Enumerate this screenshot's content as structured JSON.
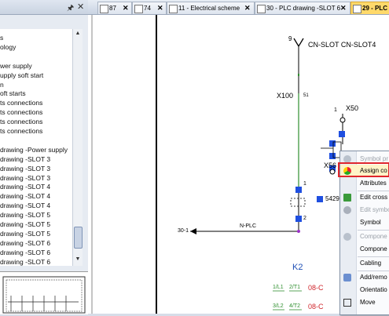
{
  "left_panel": {
    "pin_icon": "pin-icon",
    "tree_items": [
      {
        "label": "s"
      },
      {
        "label": "ology"
      },
      {
        "label": ""
      },
      {
        "label": "wer supply"
      },
      {
        "label": "upply soft start"
      },
      {
        "label": "n"
      },
      {
        "label": "oft starts"
      },
      {
        "label": "ts connections"
      },
      {
        "label": "ts connections"
      },
      {
        "label": "ts connections"
      },
      {
        "label": "ts connections"
      },
      {
        "label": ""
      },
      {
        "label": "drawing -Power supply"
      },
      {
        "label": "drawing -SLOT 3"
      },
      {
        "label": "drawing -SLOT 3"
      },
      {
        "label": "drawing -SLOT 3"
      },
      {
        "label": "drawing -SLOT 4"
      },
      {
        "label": "drawing -SLOT 4"
      },
      {
        "label": "drawing -SLOT 4"
      },
      {
        "label": "drawing -SLOT 5"
      },
      {
        "label": "drawing -SLOT 5"
      },
      {
        "label": "drawing -SLOT 5"
      },
      {
        "label": "drawing -SLOT 6"
      },
      {
        "label": "drawing -SLOT 6"
      },
      {
        "label": "drawing -SLOT 6"
      }
    ]
  },
  "tabs": [
    {
      "label": "87",
      "active": false
    },
    {
      "label": "74",
      "active": false
    },
    {
      "label": "11 - Electrical scheme",
      "active": false
    },
    {
      "label": "30 - PLC drawing -SLOT 6",
      "active": false
    },
    {
      "label": "29 - PLC",
      "active": true
    }
  ],
  "drawing": {
    "connector_number": "9",
    "connector_label": "CN-SLOT CN-SLOT4",
    "wire_label": "X100",
    "wire_number": "51",
    "x50_label": "X50",
    "x50_pin": "1",
    "x56_label": "X56",
    "pin_1": "1",
    "pin_2": "2",
    "terminal_5429": "5429",
    "arrow_label": "30-1",
    "nplc_label": "N-PLC",
    "k2_label": "K2",
    "contacts": [
      {
        "left": "1/L1",
        "mid": "2/T1",
        "ref": "08-C"
      },
      {
        "left": "3/L2",
        "mid": "4/T2",
        "ref": "08-C"
      }
    ]
  },
  "context_menu": {
    "items": [
      {
        "label": "Symbol pr",
        "icon": "info-icon",
        "disabled": true
      },
      {
        "label": "Assign co",
        "icon": "assign-icon",
        "disabled": false,
        "highlight": true
      },
      {
        "label": "Attributes",
        "icon": "",
        "disabled": false
      },
      {
        "label": "Edit cross",
        "icon": "cross-icon",
        "disabled": false
      },
      {
        "label": "Edit symbo",
        "icon": "symbol-icon",
        "disabled": true
      },
      {
        "label": "Symbol",
        "icon": "",
        "disabled": false
      },
      {
        "label": "Compone",
        "icon": "info-icon",
        "disabled": true
      },
      {
        "label": "Compone",
        "icon": "",
        "disabled": false
      },
      {
        "label": "Cabling",
        "icon": "",
        "disabled": false
      },
      {
        "label": "Add/remo",
        "icon": "add-remove-icon",
        "disabled": false
      },
      {
        "label": "Orientatio",
        "icon": "",
        "disabled": false
      },
      {
        "label": "Move",
        "icon": "move-icon",
        "disabled": false
      }
    ]
  },
  "colors": {
    "active_tab": "#ffd96a",
    "highlight_border": "#e0262c",
    "wire_green": "#2f8f2f",
    "ref_red": "#d0262c",
    "k2_blue": "#1f4fb5",
    "handle_blue": "#1f4fe0"
  }
}
